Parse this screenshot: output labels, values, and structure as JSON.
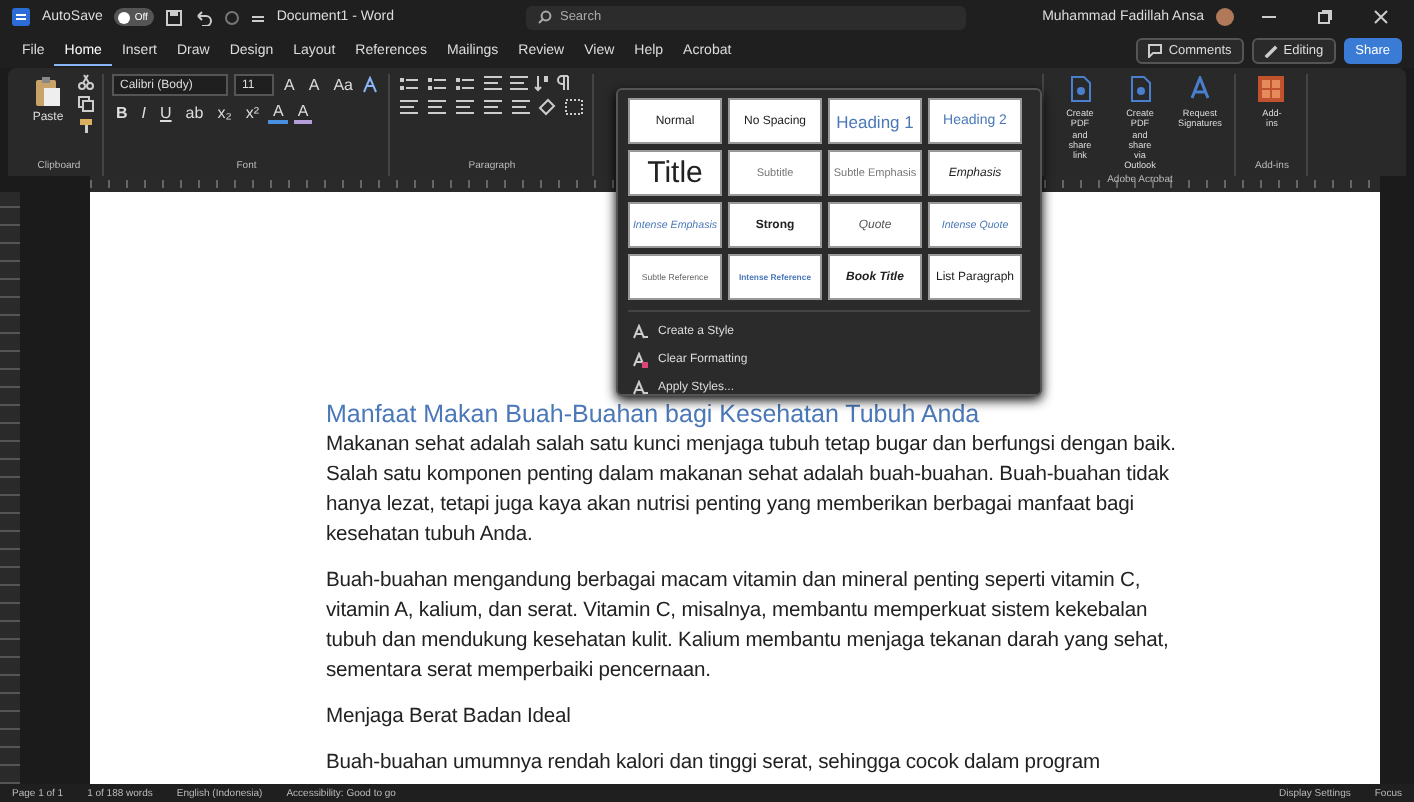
{
  "title_bar": {
    "autosave_label": "AutoSave",
    "autosave": {
      "on": false,
      "label": "Off"
    },
    "document_title": "Document1 - Word",
    "search_placeholder": "Search",
    "user_name": "Muhammad Fadillah Ansa"
  },
  "menu_tabs": [
    {
      "label": "File",
      "selected": false
    },
    {
      "label": "Home",
      "selected": true
    },
    {
      "label": "Insert",
      "selected": false
    },
    {
      "label": "Draw",
      "selected": false
    },
    {
      "label": "Design",
      "selected": false
    },
    {
      "label": "Layout",
      "selected": false
    },
    {
      "label": "References",
      "selected": false
    },
    {
      "label": "Mailings",
      "selected": false
    },
    {
      "label": "Review",
      "selected": false
    },
    {
      "label": "View",
      "selected": false
    },
    {
      "label": "Help",
      "selected": false
    },
    {
      "label": "Acrobat",
      "selected": false
    }
  ],
  "header_buttons": {
    "comments": "Comments",
    "editing": "Editing",
    "share": "Share"
  },
  "ribbon": {
    "paste": "Paste",
    "font_name": "Calibri (Body)",
    "font_size": "11",
    "font_row1": [
      {
        "kind": "text",
        "label": "A"
      },
      {
        "kind": "text",
        "label": "A"
      },
      {
        "kind": "text",
        "label": "Aa"
      }
    ],
    "font_row2": [
      {
        "kind": "bold",
        "label": "B"
      },
      {
        "kind": "italic",
        "label": "I"
      },
      {
        "kind": "underline",
        "label": "U"
      },
      {
        "kind": "text",
        "label": "ab"
      },
      {
        "kind": "text",
        "label": "x₂"
      },
      {
        "kind": "text",
        "label": "x²"
      },
      {
        "kind": "color",
        "label": "A",
        "color": "#4a8fe0"
      },
      {
        "kind": "color",
        "label": "A",
        "color": "#b39ddb"
      }
    ],
    "groups": [
      "Clipboard",
      "Font",
      "Paragraph"
    ],
    "acrobat": {
      "buttons": [
        "Create PDF and share link",
        "Create PDF and share via Outlook",
        "Request Signatures"
      ],
      "label": "Adobe Acrobat"
    },
    "addins": {
      "button": "Add-ins",
      "label": "Add-ins"
    }
  },
  "styles_gallery": {
    "styles": [
      {
        "label": "Normal",
        "kind": "normal"
      },
      {
        "label": "No Spacing",
        "kind": "normal"
      },
      {
        "label": "Heading 1",
        "kind": "heading1"
      },
      {
        "label": "Heading 2",
        "kind": "heading2"
      },
      {
        "label": "Title",
        "kind": "title"
      },
      {
        "label": "Subtitle",
        "kind": "subtle"
      },
      {
        "label": "Subtle Emphasis",
        "kind": "subtle"
      },
      {
        "label": "Emphasis",
        "kind": "emphasis"
      },
      {
        "label": "Intense Emphasis",
        "kind": "intense"
      },
      {
        "label": "Strong",
        "kind": "strong"
      },
      {
        "label": "Quote",
        "kind": "quote"
      },
      {
        "label": "Intense Quote",
        "kind": "intense"
      },
      {
        "label": "Subtle Reference",
        "kind": "subref"
      },
      {
        "label": "Intense Reference",
        "kind": "intref"
      },
      {
        "label": "Book Title",
        "kind": "book"
      },
      {
        "label": "List Paragraph",
        "kind": "normal"
      }
    ],
    "menu": [
      "Create a Style",
      "Clear Formatting",
      "Apply Styles..."
    ]
  },
  "document": {
    "heading": "Manfaat Makan Buah-Buahan bagi Kesehatan Tubuh Anda",
    "paragraphs": [
      "Makanan sehat adalah salah satu kunci menjaga tubuh tetap bugar dan berfungsi dengan baik. Salah satu komponen penting dalam makanan sehat adalah buah-buahan. Buah-buahan tidak hanya lezat, tetapi juga kaya akan nutrisi penting yang memberikan berbagai manfaat bagi kesehatan tubuh Anda.",
      "Buah-buahan mengandung berbagai macam vitamin dan mineral penting seperti vitamin C, vitamin A, kalium, dan serat. Vitamin C, misalnya, membantu memperkuat sistem kekebalan tubuh dan mendukung kesehatan kulit. Kalium membantu menjaga tekanan darah yang sehat, sementara serat memperbaiki pencernaan.",
      "Menjaga Berat Badan Ideal",
      "Buah-buahan umumnya rendah kalori dan tinggi serat, sehingga cocok dalam program"
    ]
  },
  "status_bar": {
    "left": [
      "Page 1 of 1",
      "1 of 188 words",
      "English (Indonesia)",
      "Accessibility: Good to go"
    ],
    "right": [
      "Display Settings",
      "Focus"
    ]
  }
}
